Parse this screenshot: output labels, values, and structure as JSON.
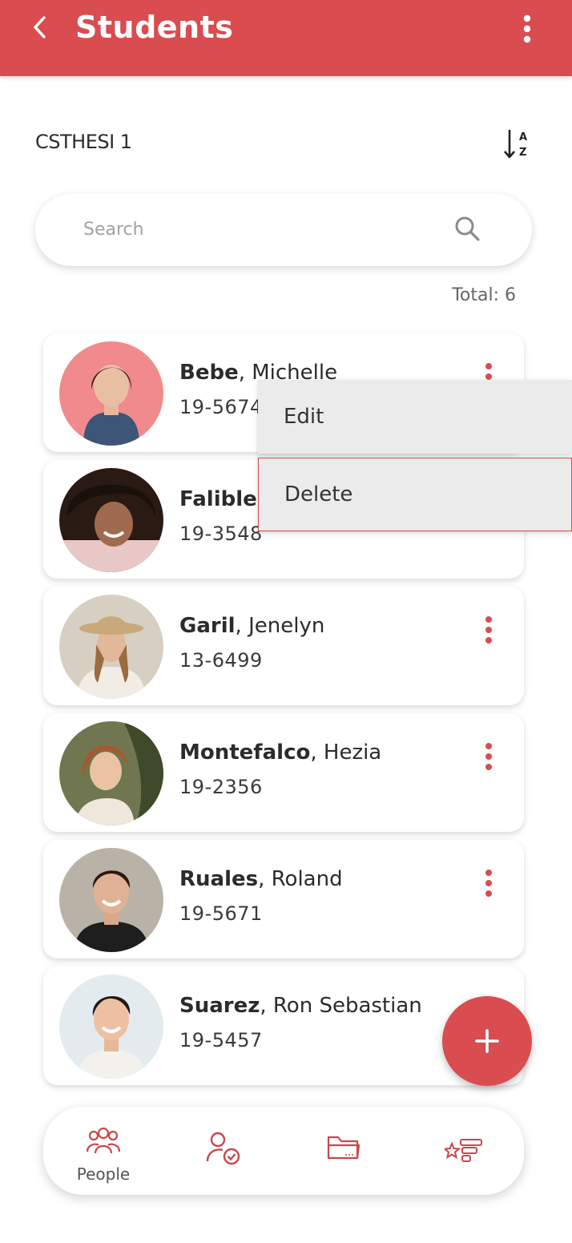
{
  "appbar": {
    "title": "Students",
    "back_icon": "back-chevron-icon",
    "more_icon": "more-vertical-icon",
    "background_color": "#d94c4f"
  },
  "class_name": "CSTHESI 1",
  "sort_icon": "sort-alpha-icon",
  "search": {
    "placeholder": "Search",
    "value": "",
    "icon": "search-icon"
  },
  "total_label": "Total: 6",
  "students": [
    {
      "last_name": "Bebe",
      "first_name": "Michelle",
      "separator": ", ",
      "id": "19-5674"
    },
    {
      "last_name": "Falible",
      "first_name": "",
      "separator": ",",
      "id": "19-3548"
    },
    {
      "last_name": "Garil",
      "first_name": "Jenelyn",
      "separator": ", ",
      "id": "13-6499"
    },
    {
      "last_name": "Montefalco",
      "first_name": "Hezia",
      "separator": ", ",
      "id": "19-2356"
    },
    {
      "last_name": "Ruales",
      "first_name": "Roland",
      "separator": ", ",
      "id": "19-5671"
    },
    {
      "last_name": "Suarez",
      "first_name": "Ron Sebastian",
      "separator": ", ",
      "id": "19-5457"
    }
  ],
  "context_menu": {
    "edit_label": "Edit",
    "delete_label": "Delete"
  },
  "fab": {
    "icon": "plus-icon"
  },
  "bottom_nav": [
    {
      "label": "People",
      "icon": "people-icon",
      "active": true
    },
    {
      "label": "",
      "icon": "user-check-icon",
      "active": false
    },
    {
      "label": "",
      "icon": "folder-icon",
      "active": false
    },
    {
      "label": "",
      "icon": "star-list-icon",
      "active": false
    }
  ],
  "colors": {
    "accent": "#d94c4f",
    "menu_bg": "#ebebeb"
  }
}
